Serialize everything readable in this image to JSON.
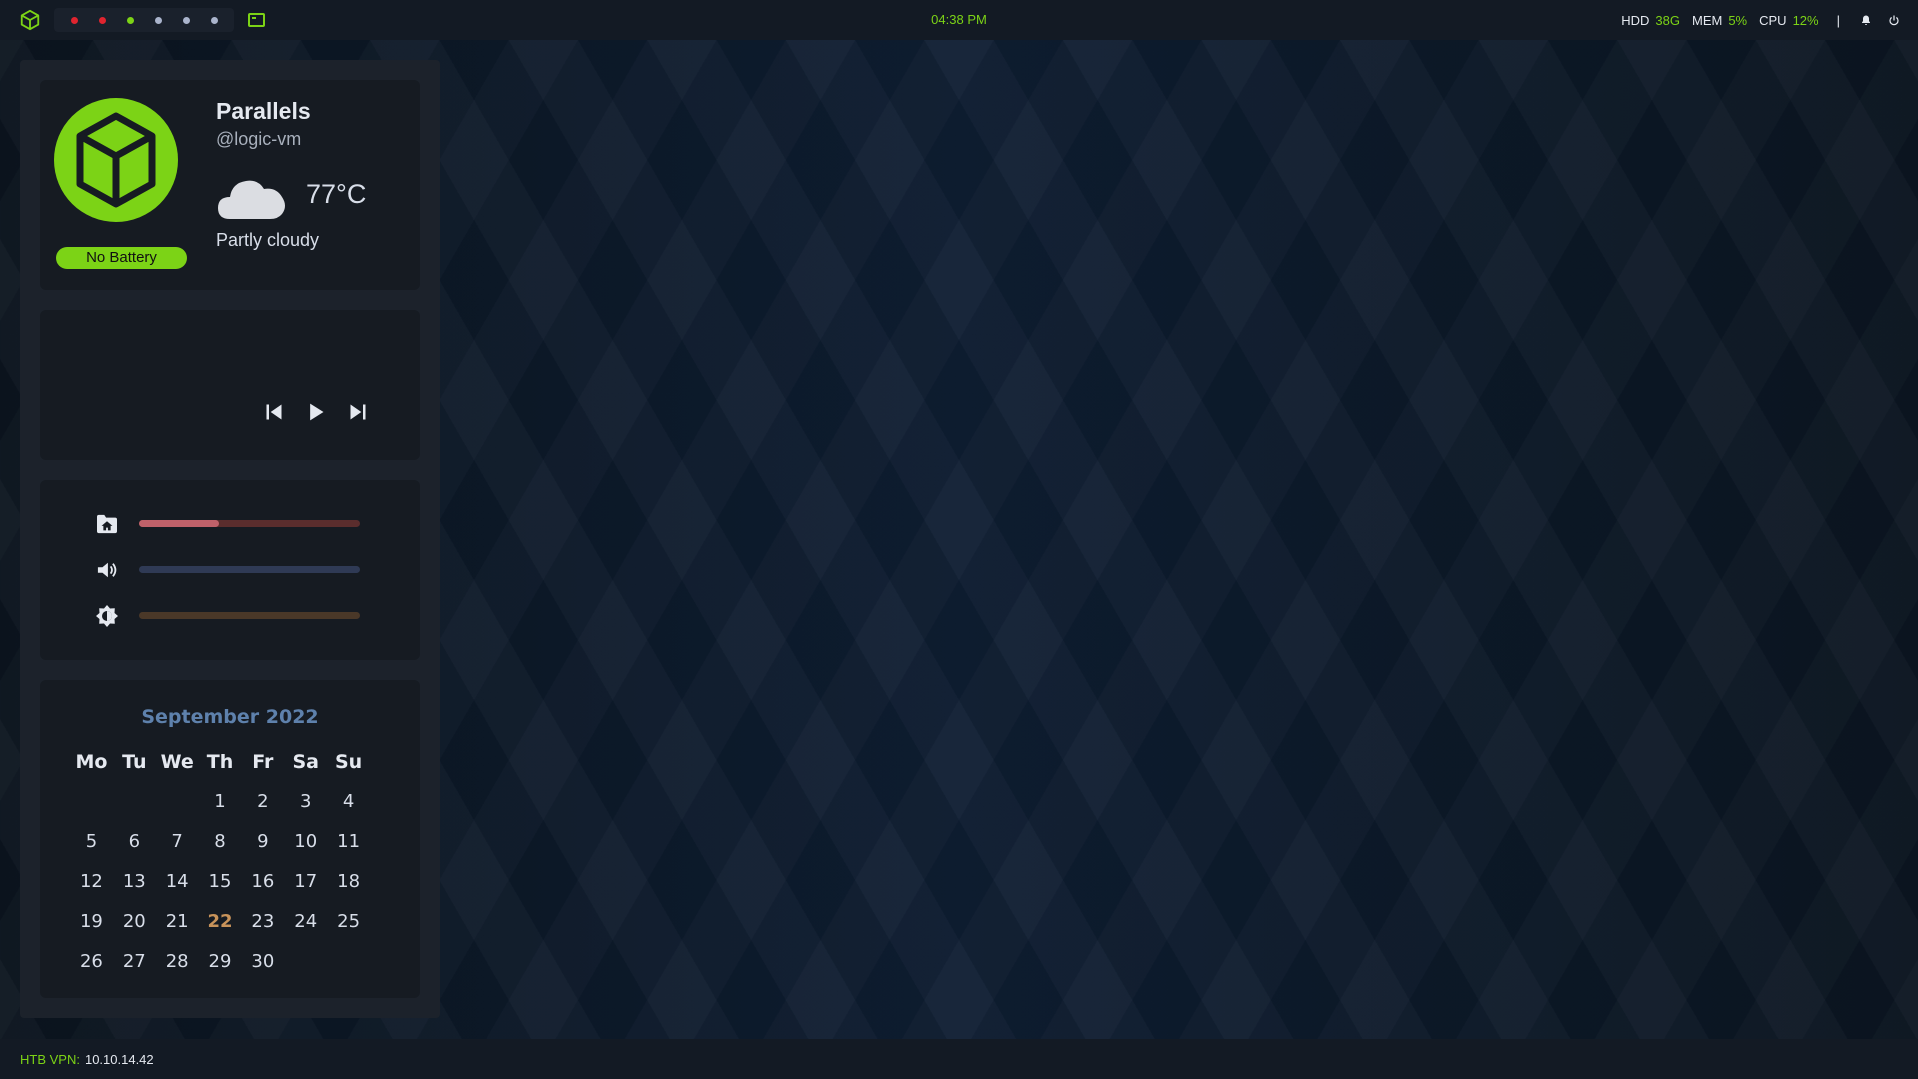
{
  "topbar": {
    "logo_icon": "cube-icon",
    "workspaces": [
      {
        "color": "#e0242f",
        "active": false
      },
      {
        "color": "#e0242f",
        "active": false
      },
      {
        "color": "#7cd316",
        "active": true
      },
      {
        "color": "#aab4cc",
        "active": false
      },
      {
        "color": "#aab4cc",
        "active": false
      },
      {
        "color": "#aab4cc",
        "active": false
      }
    ],
    "terminal_icon": "terminal-icon",
    "clock": "04:38 PM",
    "stats": {
      "hdd_label": "HDD",
      "hdd_value": "38G",
      "mem_label": "MEM",
      "mem_value": "5%",
      "cpu_label": "CPU",
      "cpu_value": "12%"
    },
    "separator": "|",
    "bell_icon": "bell-icon",
    "power_icon": "power-icon"
  },
  "profile": {
    "name": "Parallels",
    "handle": "@logic-vm",
    "battery": "No Battery",
    "weather": {
      "icon": "cloud-icon",
      "temp": "77°C",
      "condition": "Partly cloudy"
    }
  },
  "music": {
    "prev_icon": "skip-previous-icon",
    "play_icon": "play-icon",
    "next_icon": "skip-next-icon"
  },
  "sliders": [
    {
      "name": "disk",
      "icon": "folder-home-icon",
      "level": 0.36,
      "track": "#5a2d2d",
      "fill": "#bf616a"
    },
    {
      "name": "volume",
      "icon": "volume-icon",
      "level": 0.0,
      "track": "#2f3a55",
      "fill": "#5e81ac"
    },
    {
      "name": "brightness",
      "icon": "brightness-icon",
      "level": 0.0,
      "track": "#4a3828",
      "fill": "#d08770"
    }
  ],
  "calendar": {
    "title": "September 2022",
    "weekdays": [
      "Mo",
      "Tu",
      "We",
      "Th",
      "Fr",
      "Sa",
      "Su"
    ],
    "weeks": [
      [
        "",
        "",
        "",
        "1",
        "2",
        "3",
        "4"
      ],
      [
        "5",
        "6",
        "7",
        "8",
        "9",
        "10",
        "11"
      ],
      [
        "12",
        "13",
        "14",
        "15",
        "16",
        "17",
        "18"
      ],
      [
        "19",
        "20",
        "21",
        "22",
        "23",
        "24",
        "25"
      ],
      [
        "26",
        "27",
        "28",
        "29",
        "30",
        "",
        ""
      ]
    ],
    "today": "22"
  },
  "bottombar": {
    "vpn_label": "HTB VPN:",
    "vpn_ip": "10.10.14.42"
  },
  "colors": {
    "accent": "#7cd316",
    "bar_bg": "#131a24",
    "panel_bg": "#1c222b",
    "card_bg": "#161b22"
  }
}
